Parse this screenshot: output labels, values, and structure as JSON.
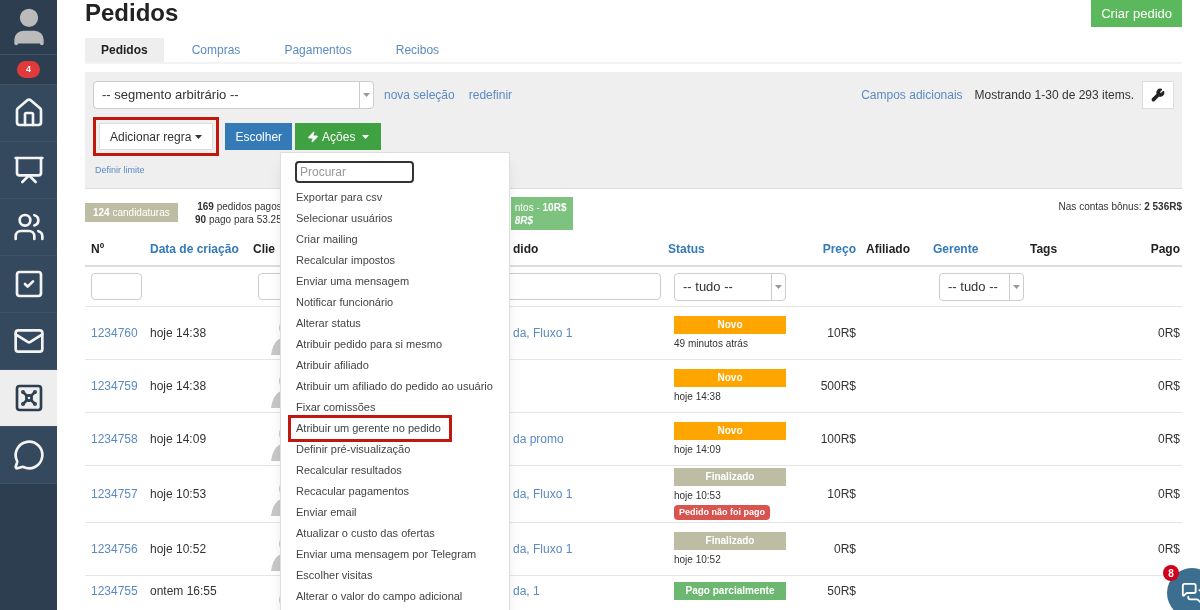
{
  "sidebar": {
    "notification_count": "4",
    "items": [
      {
        "kind": "home",
        "selected": false
      },
      {
        "kind": "chart",
        "selected": false
      },
      {
        "kind": "people",
        "selected": false
      },
      {
        "kind": "tasks",
        "selected": false
      },
      {
        "kind": "mail",
        "selected": false
      },
      {
        "kind": "safe",
        "selected": true
      },
      {
        "kind": "chat",
        "selected": false
      }
    ]
  },
  "title": "Pedidos",
  "create_button": "Criar pedido",
  "tabs": [
    {
      "label": "Pedidos",
      "selected": true
    },
    {
      "label": "Compras",
      "selected": false
    },
    {
      "label": "Pagamentos",
      "selected": false
    },
    {
      "label": "Recibos",
      "selected": false
    }
  ],
  "filter": {
    "segment": "-- segmento arbitrário --",
    "links": [
      "nova seleção",
      "redefinir"
    ],
    "extra_fields": "Campos adicionais",
    "showing": "Mostrando 1-30 de 293 items.",
    "add_rule": {
      "label": "Adicionar regra",
      "highlighted": true
    },
    "choose": "Escolher",
    "actions": "Ações",
    "limit": "Definir limite"
  },
  "actions_menu": {
    "search_placeholder": "Procurar",
    "items": [
      {
        "label": "Exportar para csv",
        "highlighted": false
      },
      {
        "label": "Selecionar usuários",
        "highlighted": false
      },
      {
        "label": "Criar mailing",
        "highlighted": false
      },
      {
        "label": "Recalcular impostos",
        "highlighted": false
      },
      {
        "label": "Enviar uma mensagem",
        "highlighted": false
      },
      {
        "label": "Notificar funcionário",
        "highlighted": false
      },
      {
        "label": "Alterar status",
        "highlighted": false
      },
      {
        "label": "Atribuir pedido para si mesmo",
        "highlighted": false
      },
      {
        "label": "Atribuir afiliado",
        "highlighted": false
      },
      {
        "label": "Atribuir um afiliado do pedido ao usuário",
        "highlighted": false
      },
      {
        "label": "Fixar comissões",
        "highlighted": false
      },
      {
        "label": "Atribuir um gerente no pedido",
        "highlighted": true
      },
      {
        "label": "Definir pré-visualização",
        "highlighted": false
      },
      {
        "label": "Recalcular resultados",
        "highlighted": false
      },
      {
        "label": "Recacular pagamentos",
        "highlighted": false
      },
      {
        "label": "Enviar email",
        "highlighted": false
      },
      {
        "label": "Atualizar o custo das ofertas",
        "highlighted": false
      },
      {
        "label": "Enviar uma mensagem por Telegram",
        "highlighted": false
      },
      {
        "label": "Escolher visitas",
        "highlighted": false
      },
      {
        "label": "Alterar o valor do campo adicional",
        "highlighted": false
      }
    ]
  },
  "stats": {
    "applications": "**124** candidaturas",
    "paid_orders": "**169** pedidos pagos",
    "paid_share": "**90** pago para 53.25",
    "green_line_1": "ntos - **10R$**",
    "green_line_2": "8R$",
    "bonus": "Nas contas bônus: **2 536R$**"
  },
  "table": {
    "columns": [
      {
        "label": "Nº",
        "sortable": false
      },
      {
        "label": "Data de criação",
        "sortable": true
      },
      {
        "label": "Clie",
        "sortable": false
      },
      {
        "label": "dido",
        "sortable": false
      },
      {
        "label": "Status",
        "sortable": true
      },
      {
        "label": "Preço",
        "sortable": true
      },
      {
        "label": "Afiliado",
        "sortable": false
      },
      {
        "label": "Gerente",
        "sortable": true
      },
      {
        "label": "Tags",
        "sortable": false
      },
      {
        "label": "Pago",
        "sortable": false
      }
    ],
    "status_filter": "-- tudo --",
    "manager_filter": "-- tudo --",
    "rows": [
      {
        "number": "1234760",
        "date": "hoje 14:38",
        "product": "da, Fluxo 1",
        "status": {
          "label": "Novo",
          "kind": "new"
        },
        "status_time": "49 minutos atrás",
        "price": "10R$",
        "paid": "0R$"
      },
      {
        "number": "1234759",
        "date": "hoje 14:38",
        "status": {
          "label": "Novo",
          "kind": "new"
        },
        "status_time": "hoje 14:38",
        "price": "500R$",
        "paid": "0R$"
      },
      {
        "number": "1234758",
        "date": "hoje 14:09",
        "product": "da promo",
        "status": {
          "label": "Novo",
          "kind": "new"
        },
        "status_time": "hoje 14:09",
        "price": "100R$",
        "paid": "0R$"
      },
      {
        "number": "1234757",
        "date": "hoje 10:53",
        "product": "da, Fluxo 1",
        "status": {
          "label": "Finalizado",
          "kind": "done"
        },
        "status_time": "hoje 10:53",
        "warning": "Pedido não foi pago",
        "price": "10R$",
        "paid": "0R$"
      },
      {
        "number": "1234756",
        "date": "hoje 10:52",
        "product": "da, Fluxo 1",
        "status": {
          "label": "Finalizado",
          "kind": "done"
        },
        "status_time": "hoje 10:52",
        "price": "0R$",
        "paid": "0R$"
      },
      {
        "number": "1234755",
        "date": "ontem 16:55",
        "product": "da, 1",
        "status": {
          "label": "Pago parcialmente",
          "kind": "partial"
        },
        "price": "50R$"
      }
    ]
  },
  "chat_badge": "8"
}
